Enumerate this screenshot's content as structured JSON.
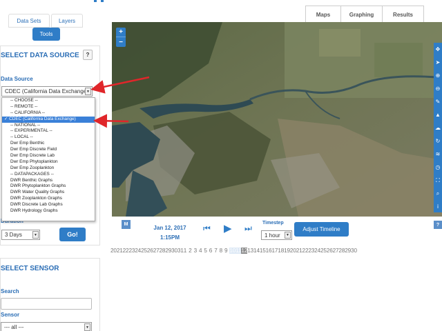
{
  "header": {
    "tabs": [
      {
        "label": "Maps"
      },
      {
        "label": "Graphing"
      },
      {
        "label": "Results"
      }
    ],
    "left_tabs": [
      {
        "label": "Data Sets"
      },
      {
        "label": "Layers"
      }
    ],
    "tools_label": "Tools"
  },
  "source_panel": {
    "title": "SELECT DATA SOURCE",
    "help": "?",
    "data_source_label": "Data Source",
    "selected_value": "CDEC (California Data Exchange)",
    "duration_label": "Duration",
    "duration_value": "3 Days",
    "go_label": "Go!"
  },
  "dropdown": {
    "options": [
      "-- CHOOSE --",
      "-- REMOTE --",
      "-- CALIFORNIA --",
      "CDEC (California Data Exchange)",
      "-- NATIONAL --",
      "-- EXPERIMENTAL --",
      "-- LOCAL --",
      "Dwr Emp Benthic",
      "Dwr Emp Discrete Field",
      "Dwr Emp Discrete Lab",
      "Dwr Emp Phytoplankton",
      "Dwr Emp Zooplankton",
      "-- DATAPACKAGES --",
      "DWR Benthic Graphs",
      "DWR Phytoplankton Graphs",
      "DWR Water Quality Graphs",
      "DWR Zooplankton Graphs",
      "DWR Discrete Lab Graphs",
      "DWR Hydrology Graphs"
    ],
    "selected_index": 3,
    "checkmark": "✓"
  },
  "sensor_panel": {
    "title": "SELECT SENSOR",
    "search_label": "Search",
    "search_value": "",
    "sensor_label": "Sensor",
    "sensor_value": "--- all ---"
  },
  "map": {
    "zoom_in": "+",
    "zoom_out": "−",
    "tool_icons": [
      "pan-icon",
      "pointer-icon",
      "zoom-in-icon",
      "zoom-out-icon",
      "draw-icon",
      "measure-icon",
      "cloud-icon",
      "rotate-icon",
      "layers-icon",
      "clock-icon",
      "fullscreen-icon",
      "search-icon",
      "info-icon"
    ]
  },
  "timeline": {
    "m_label": "M",
    "date": "Jan 12, 2017",
    "time": "1:15PM",
    "timestep_label": "Timestep",
    "timestep_value": "1 hour",
    "adjust_label": "Adjust Timeline",
    "help": "?",
    "days": [
      "20",
      "21",
      "22",
      "23",
      "24",
      "25",
      "26",
      "27",
      "28",
      "29",
      "30",
      "31",
      "1",
      "2",
      "3",
      "4",
      "5",
      "6",
      "7",
      "8",
      "9",
      "10",
      "11",
      "12",
      "13",
      "14",
      "15",
      "16",
      "17",
      "18",
      "19",
      "20",
      "21",
      "22",
      "23",
      "24",
      "25",
      "26",
      "27",
      "28",
      "29",
      "30"
    ],
    "highlight_light": [
      "10",
      "11"
    ],
    "highlight_dark": "12"
  },
  "colors": {
    "accent": "#2f7dc7",
    "arrow": "#e0262a",
    "title": "#2a6db5"
  }
}
